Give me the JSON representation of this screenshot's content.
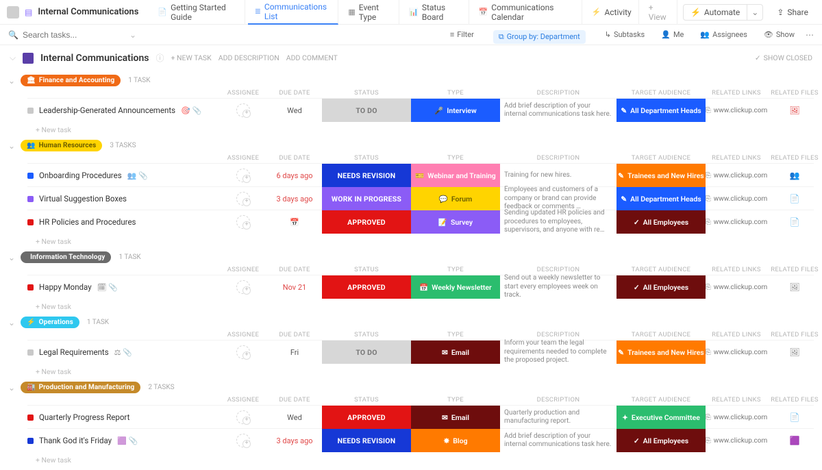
{
  "header": {
    "workspace_title": "Internal Communications",
    "tabs": [
      {
        "label": "Getting Started Guide"
      },
      {
        "label": "Communications List",
        "active": true
      },
      {
        "label": "Event Type"
      },
      {
        "label": "Status Board"
      },
      {
        "label": "Communications Calendar"
      },
      {
        "label": "Activity"
      }
    ],
    "add_view_label": "+  View",
    "automate_label": "Automate",
    "share_label": "Share"
  },
  "toolbar": {
    "search_placeholder": "Search tasks...",
    "filter": "Filter",
    "group_by": "Group by: Department",
    "subtasks": "Subtasks",
    "me": "Me",
    "assignees": "Assignees",
    "show": "Show"
  },
  "page": {
    "title": "Internal Communications",
    "new_task": "+ NEW TASK",
    "add_desc": "ADD DESCRIPTION",
    "add_comment": "ADD COMMENT",
    "show_closed": "SHOW CLOSED"
  },
  "columns": [
    "ASSIGNEE",
    "DUE DATE",
    "STATUS",
    "TYPE",
    "DESCRIPTION",
    "TARGET AUDIENCE",
    "RELATED LINKS",
    "RELATED FILES"
  ],
  "new_task_row": "+ New task",
  "link_icon": "⎘",
  "groups": [
    {
      "name": "Finance and Accounting",
      "pill_icon": "🏛",
      "pill_color": "#f06a16",
      "count": "1 TASK",
      "rows": [
        {
          "sq": "#c9c9c9",
          "title": "Leadership-Generated Announcements",
          "icons": "🎯 📎",
          "due": "Wed",
          "overdue": false,
          "status": {
            "text": "TO DO",
            "bg": "#d7d7d7",
            "fg": "#777"
          },
          "type": {
            "text": "Interview",
            "icon": "🎤",
            "bg": "#1b5cff"
          },
          "desc": "Add brief description of your internal communications task here.",
          "aud": {
            "text": "All Department Heads",
            "icon": "✎",
            "bg": "#1b5cff"
          },
          "link": "www.clickup.com",
          "file": "🖼",
          "file_color": "#e04848"
        }
      ]
    },
    {
      "name": "Human Resources",
      "pill_icon": "👥",
      "pill_color": "#ffd400",
      "pill_fg": "#6b5d00",
      "count": "3 TASKS",
      "rows": [
        {
          "sq": "#1b5cff",
          "title": "Onboarding Procedures",
          "icons": "👥 📎",
          "due": "6 days ago",
          "overdue": true,
          "status": {
            "text": "NEEDS REVISION",
            "bg": "#1638d6"
          },
          "type": {
            "text": "Webinar and Training",
            "icon": "🎫",
            "bg": "#ff7fb2"
          },
          "desc": "Training for new hires.",
          "aud": {
            "text": "Trainees and New Hires",
            "icon": "✎",
            "bg": "#ff7a00"
          },
          "link": "www.clickup.com",
          "file": "👥",
          "file_color": "#333"
        },
        {
          "sq": "#8b5cf6",
          "title": "Virtual Suggestion Boxes",
          "icons": "",
          "due": "3 days ago",
          "overdue": true,
          "status": {
            "text": "WORK IN PROGRESS",
            "bg": "#8b5cf6"
          },
          "type": {
            "text": "Forum",
            "icon": "💬",
            "bg": "#ffd400",
            "fg": "#6b5d00"
          },
          "desc": "Employees and customers of a company or brand can provide feedback or comments …",
          "aud": {
            "text": "All Department Heads",
            "icon": "✎",
            "bg": "#1b5cff"
          },
          "link": "www.clickup.com",
          "file": "📄",
          "file_color": "#c8c8c8"
        },
        {
          "sq": "#e21414",
          "title": "HR Policies and Procedures",
          "icons": "",
          "due": "",
          "overdue": false,
          "due_icon": true,
          "status": {
            "text": "APPROVED",
            "bg": "#e21414"
          },
          "type": {
            "text": "Survey",
            "icon": "📝",
            "bg": "#8b5cf6"
          },
          "desc": "Sending updated HR policies and procedures to employees, supervisors, and anyone with re…",
          "aud": {
            "text": "All Employees",
            "icon": "✓",
            "bg": "#6e0d0d"
          },
          "link": "www.clickup.com",
          "file": "📄",
          "file_color": "#c8c8c8"
        }
      ]
    },
    {
      "name": "Information Technology",
      "pill_icon": "",
      "pill_color": "#6b6b6b",
      "count": "1 TASK",
      "rows": [
        {
          "sq": "#e21414",
          "title": "Happy Monday",
          "icons": "🗓 📎",
          "due": "Nov 21",
          "overdue": true,
          "status": {
            "text": "APPROVED",
            "bg": "#e21414"
          },
          "type": {
            "text": "Weekly Newsletter",
            "icon": "📅",
            "bg": "#2bbd6e"
          },
          "desc": "Send out a weekly newsletter to start every employees week on track.",
          "aud": {
            "text": "All Employees",
            "icon": "✓",
            "bg": "#6e0d0d"
          },
          "link": "www.clickup.com",
          "file": "🖼",
          "file_color": "#888"
        }
      ]
    },
    {
      "name": "Operations",
      "pill_icon": "⚡",
      "pill_color": "#2fc8ef",
      "count": "1 TASK",
      "rows": [
        {
          "sq": "#c9c9c9",
          "title": "Legal Requirements",
          "icons": "⚖ 📎",
          "due": "Fri",
          "overdue": false,
          "status": {
            "text": "TO DO",
            "bg": "#d7d7d7",
            "fg": "#777"
          },
          "type": {
            "text": "Email",
            "icon": "✉",
            "bg": "#6e0d0d"
          },
          "desc": "Inform your team the legal requirements needed to complete the proposed project.",
          "aud": {
            "text": "Trainees and New Hires",
            "icon": "✎",
            "bg": "#ff7a00"
          },
          "link": "www.clickup.com",
          "file": "🖼",
          "file_color": "#888"
        }
      ]
    },
    {
      "name": "Production and Manufacturing",
      "pill_icon": "🏭",
      "pill_color": "#c58a2a",
      "count": "2 TASKS",
      "rows": [
        {
          "sq": "#e21414",
          "title": "Quarterly Progress Report",
          "icons": "",
          "due": "Wed",
          "overdue": false,
          "status": {
            "text": "APPROVED",
            "bg": "#e21414"
          },
          "type": {
            "text": "Email",
            "icon": "✉",
            "bg": "#6e0d0d"
          },
          "desc": "Quarterly production and manufacturing report.",
          "aud": {
            "text": "Executive Committee",
            "icon": "✦",
            "bg": "#2bbd6e"
          },
          "link": "www.clickup.com",
          "file": "📄",
          "file_color": "#c8c8c8"
        },
        {
          "sq": "#1638d6",
          "title": "Thank God it's Friday",
          "icons": "🟪 📎",
          "due": "3 days ago",
          "overdue": true,
          "status": {
            "text": "NEEDS REVISION",
            "bg": "#1638d6"
          },
          "type": {
            "text": "Blog",
            "icon": "✸",
            "bg": "#ff7a00"
          },
          "desc": "Add brief description of your internal communications task here.",
          "aud": {
            "text": "All Employees",
            "icon": "✓",
            "bg": "#6e0d0d"
          },
          "link": "www.clickup.com",
          "file": "🟪",
          "file_color": "#8b5cf6"
        }
      ]
    }
  ]
}
